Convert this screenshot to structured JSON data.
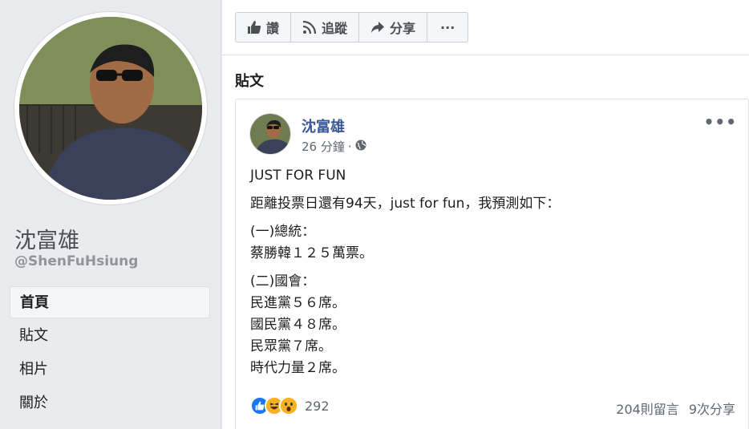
{
  "sidebar": {
    "page_name": "沈富雄",
    "handle": "@ShenFuHsiung",
    "nav": [
      {
        "label": "首頁"
      },
      {
        "label": "貼文"
      },
      {
        "label": "相片"
      },
      {
        "label": "關於"
      }
    ]
  },
  "toolbar": {
    "like_label": "讚",
    "follow_label": "追蹤",
    "share_label": "分享",
    "more_label": "···"
  },
  "section_title": "貼文",
  "post": {
    "author": "沈富雄",
    "time": "26 分鐘",
    "privacy_icon": "globe-icon",
    "more_label": "•••",
    "title": "JUST FOR FUN",
    "intro": "距離投票日還有94天，just for fun，我預測如下：",
    "section1_heading": "(一)總統：",
    "section1_line1": "蔡勝韓１２５萬票。",
    "section2_heading": "(二)國會：",
    "section2_line1": "民進黨５６席。",
    "section2_line2": "國民黨４８席。",
    "section2_line3": "民眾黨７席。",
    "section2_line4": "時代力量２席。",
    "reaction_count": "292",
    "comments": "204則留言",
    "shares": "9次分享"
  },
  "colors": {
    "link_blue": "#385898",
    "like_blue": "#1877f2",
    "haha_yellow": "#f7b125"
  }
}
